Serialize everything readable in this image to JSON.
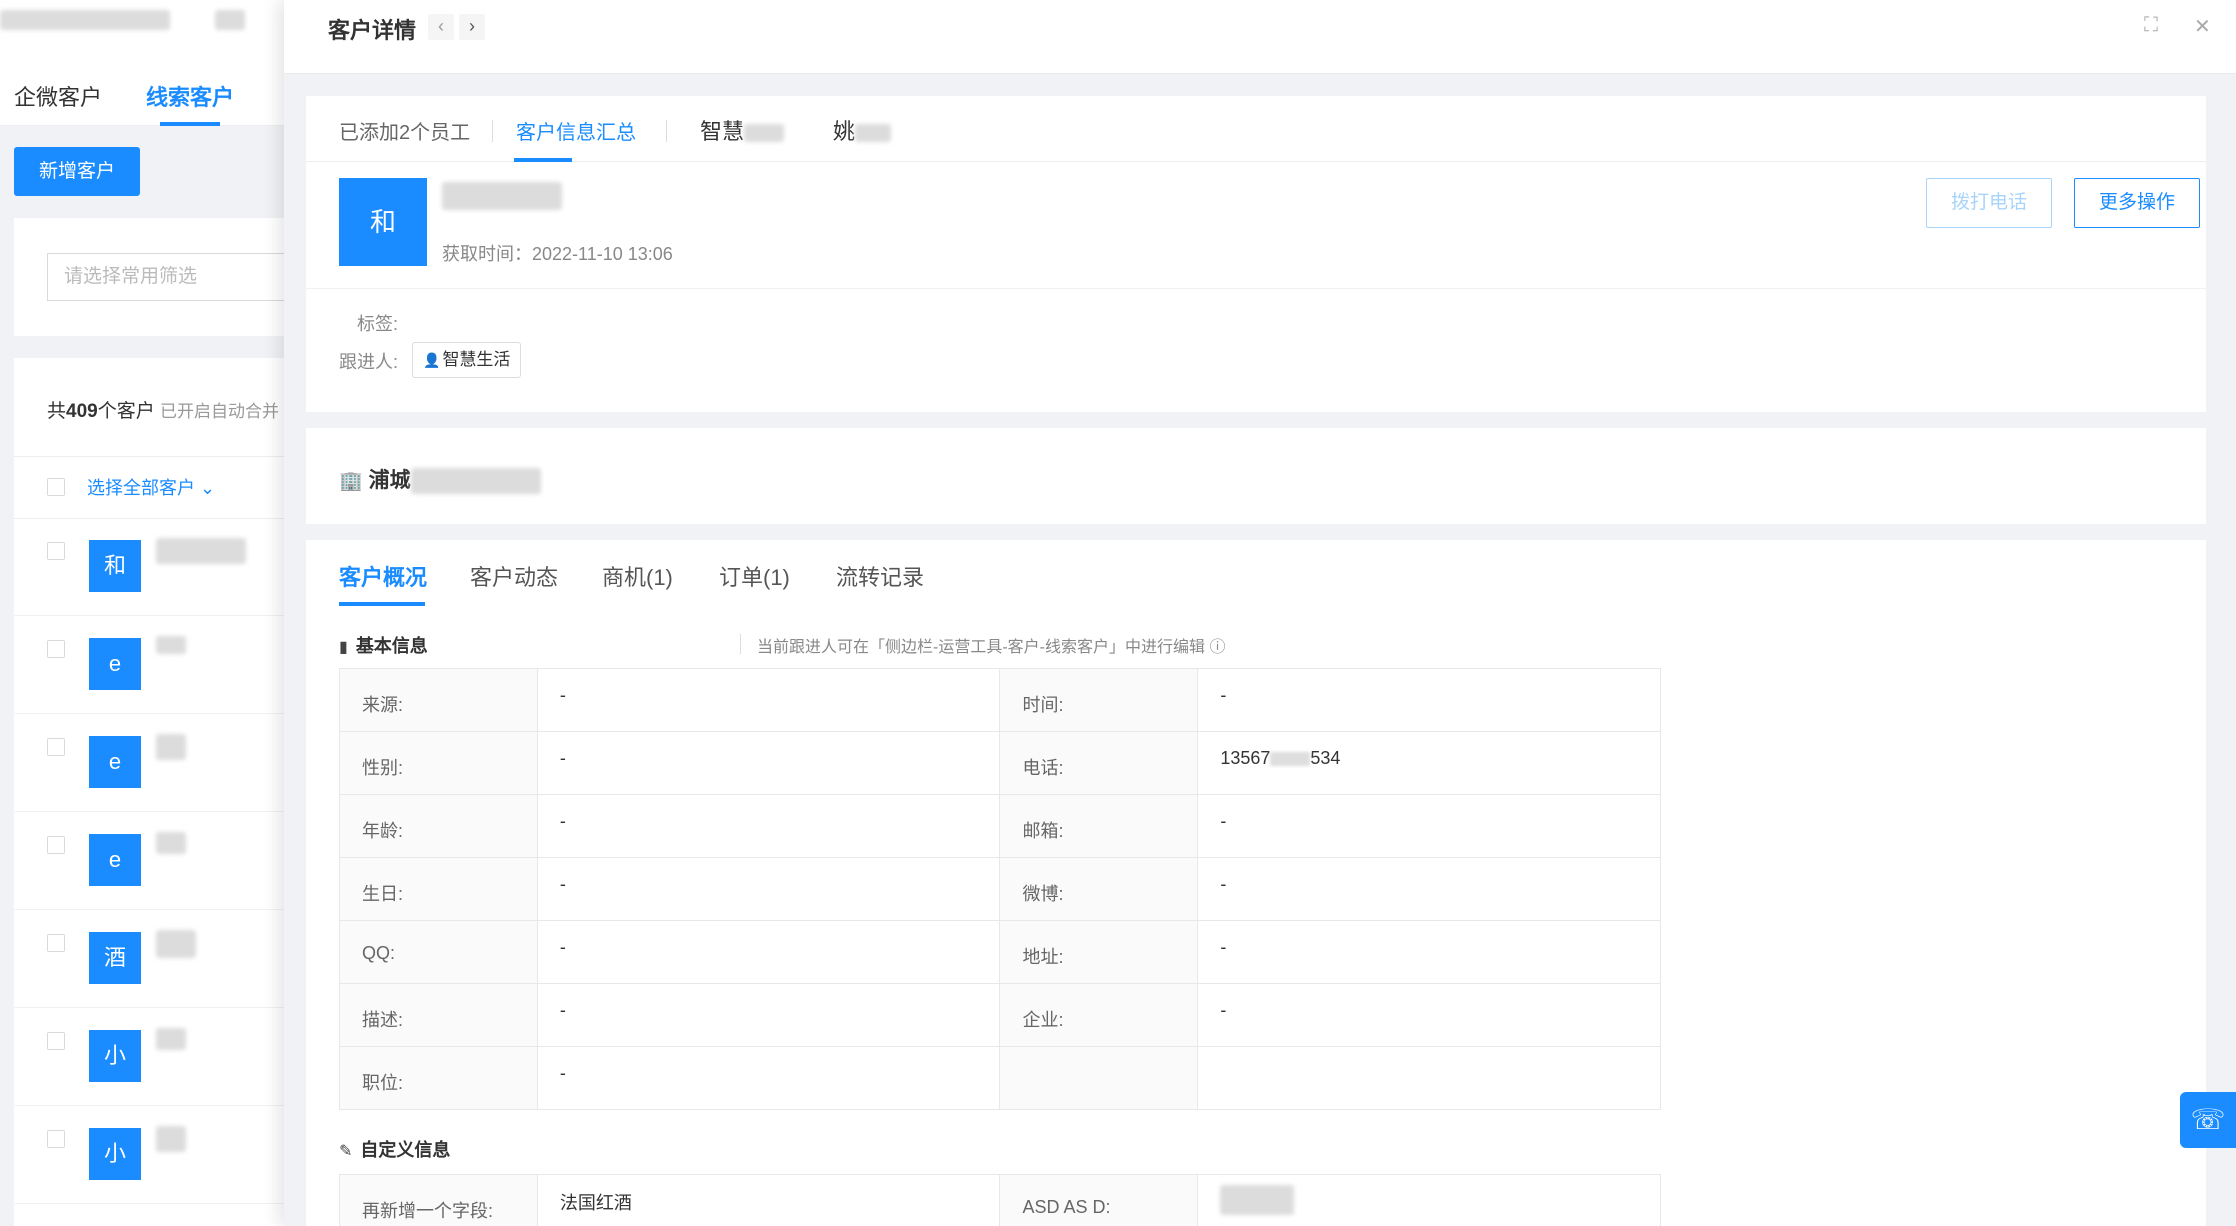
{
  "background_list": {
    "tabs": [
      "企微客户",
      "线索客户"
    ],
    "add_button": "新增客户",
    "filter_placeholder": "请选择常用筛选",
    "count_prefix": "共",
    "count_value": "409",
    "count_suffix": "个客户",
    "auto_merge_hint": "已开启自动合并",
    "select_all": "选择全部客户",
    "rows": [
      {
        "avatar": "和"
      },
      {
        "avatar": "e"
      },
      {
        "avatar": "e"
      },
      {
        "avatar": "e"
      },
      {
        "avatar": "酒"
      },
      {
        "avatar": "小"
      },
      {
        "avatar": "小"
      }
    ]
  },
  "drawer": {
    "title": "客户详情",
    "prev_icon": "‹",
    "next_icon": "›",
    "expand_icon": "⛶",
    "close_icon": "✕"
  },
  "employee_tabs": {
    "added": "已添加2个员工",
    "summary": "客户信息汇总",
    "employee1": "智慧",
    "employee2": "姚"
  },
  "customer": {
    "avatar": "和",
    "acquired_label": "获取时间：",
    "acquired_time": "2022-11-10 13:06",
    "call_button": "拨打电话",
    "more_button": "更多操作",
    "tags_label": "标签:",
    "follower_label": "跟进人:",
    "follower_name": "智慧生活"
  },
  "company": {
    "name": "浦城"
  },
  "main_tabs": [
    "客户概况",
    "客户动态",
    "商机(1)",
    "订单(1)",
    "流转记录"
  ],
  "basic_info": {
    "title": "基本信息",
    "hint": "当前跟进人可在「侧边栏-运营工具-客户-线索客户」中进行编辑",
    "rows": [
      {
        "l1": "来源:",
        "v1": "-",
        "l2": "时间:",
        "v2": "-"
      },
      {
        "l1": "性别:",
        "v1": "-",
        "l2": "电话:",
        "v2": "13567"
      },
      {
        "l1": "年龄:",
        "v1": "-",
        "l2": "邮箱:",
        "v2": "-"
      },
      {
        "l1": "生日:",
        "v1": "-",
        "l2": "微博:",
        "v2": "-"
      },
      {
        "l1": "QQ:",
        "v1": "-",
        "l2": "地址:",
        "v2": "-"
      },
      {
        "l1": "描述:",
        "v1": "-",
        "l2": "企业:",
        "v2": "-"
      },
      {
        "l1": "职位:",
        "v1": "-",
        "l2": "",
        "v2": ""
      }
    ],
    "phone_suffix": "534"
  },
  "custom_info": {
    "title": "自定义信息",
    "rows": [
      {
        "l1": "再新增一个字段:",
        "v1": "法国红酒",
        "l2": "ASD AS D:",
        "v2": ""
      }
    ]
  },
  "colors": {
    "accent": "#1a8cff",
    "background": "#f0f2f5"
  }
}
